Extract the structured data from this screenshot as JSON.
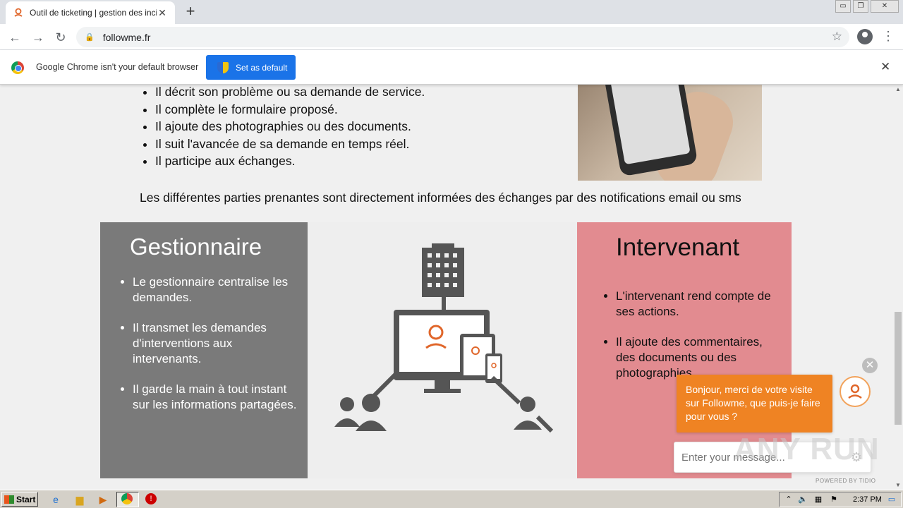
{
  "browser": {
    "tab_title": "Outil de ticketing | gestion des incidents",
    "tab_close": "✕",
    "new_tab": "+",
    "url": "followme.fr",
    "window_controls": [
      "▭",
      "❐",
      "✕"
    ]
  },
  "infobar": {
    "message": "Google Chrome isn't your default browser",
    "button_label": "Set as default",
    "close": "✕"
  },
  "content": {
    "top_bullets": [
      "Il décrit son problème ou sa demande de service.",
      "Il complète le formulaire proposé.",
      "Il ajoute des photographies ou des documents.",
      "Il suit l'avancée de sa demande en temps réel.",
      "Il participe aux échanges."
    ],
    "notification_line": "Les différentes parties prenantes sont directement informées des échanges par des notifications email ou sms",
    "gestionnaire": {
      "title": "Gestionnaire",
      "bullets": [
        "Le gestionnaire centralise les demandes.",
        "Il transmet les demandes d'interventions aux intervenants.",
        "Il garde la main à tout instant sur les informations partagées."
      ]
    },
    "intervenant": {
      "title": "Intervenant",
      "bullets": [
        "L'intervenant rend compte de ses actions.",
        "Il ajoute des commentaires, des documents ou des photographies."
      ]
    }
  },
  "chat": {
    "message": "Bonjour, merci de votre visite sur Followme, que puis-je faire pour vous ?",
    "input_placeholder": "Enter your message...",
    "powered_by": "POWERED BY TIDIO",
    "close": "✕"
  },
  "watermark": "ANY RUN",
  "taskbar": {
    "start_label": "Start",
    "clock": "2:37 PM"
  },
  "colors": {
    "accent_orange": "#ef8323",
    "panel_grey": "#7a7a7a",
    "panel_pink": "#e28b90",
    "chrome_blue": "#1a73e8"
  }
}
